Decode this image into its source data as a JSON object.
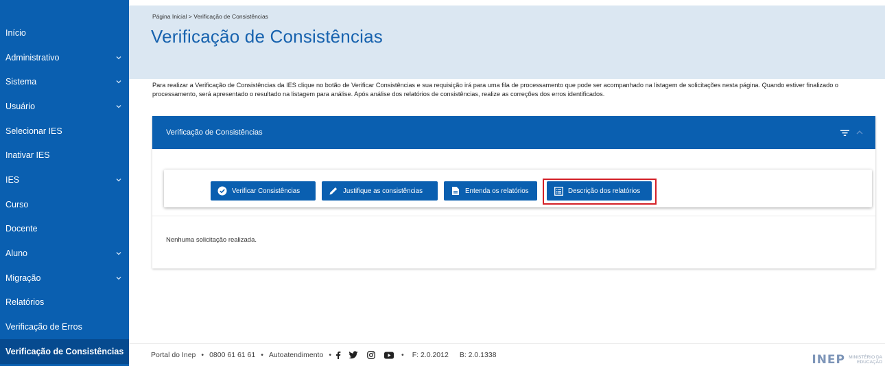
{
  "sidebar": {
    "items": [
      {
        "label": "Início",
        "has_chevron": false
      },
      {
        "label": "Administrativo",
        "has_chevron": true
      },
      {
        "label": "Sistema",
        "has_chevron": true
      },
      {
        "label": "Usuário",
        "has_chevron": true
      },
      {
        "label": "Selecionar IES",
        "has_chevron": false
      },
      {
        "label": "Inativar IES",
        "has_chevron": false
      },
      {
        "label": "IES",
        "has_chevron": true
      },
      {
        "label": "Curso",
        "has_chevron": false
      },
      {
        "label": "Docente",
        "has_chevron": false
      },
      {
        "label": "Aluno",
        "has_chevron": true
      },
      {
        "label": "Migração",
        "has_chevron": true
      },
      {
        "label": "Relatórios",
        "has_chevron": false
      },
      {
        "label": "Verificação de Erros",
        "has_chevron": false
      },
      {
        "label": "Verificação de Consistências",
        "has_chevron": false,
        "active": true
      }
    ]
  },
  "header": {
    "breadcrumb": "Página Inicial > Verificação de Consistências",
    "title": "Verificação de Consistências"
  },
  "description": "Para realizar a Verificação de Consistências da IES clique no botão de Verificar Consistências e sua requisição irá para uma fila de processamento que pode ser acompanhado na listagem de solicitações nesta página. Quando estiver finalizado o processamento, será apresentado o resultado na listagem para análise. Após análise dos relatórios de consistências, realize as correções dos erros identificados.",
  "panel": {
    "title": "Verificação de Consistências",
    "buttons": {
      "verificar": "Verificar Consistências",
      "justifique": "Justifique as consistências",
      "entenda": "Entenda os relatórios",
      "descricao": "Descrição dos relatórios"
    },
    "empty_message": "Nenhuma solicitação realizada."
  },
  "footer": {
    "portal": "Portal do Inep",
    "bullet": "•",
    "phone": "0800 61 61 61",
    "autoatendimento": "Autoatendimento",
    "frontend_version": "F: 2.0.2012",
    "backend_version": "B: 2.0.1338",
    "logo_text": "INEP",
    "ministry_text": "MINISTÉRIO DA EDUCAÇÃO"
  },
  "colors": {
    "primary": "#0a5fb0",
    "header_band": "#dbe7f2",
    "highlight": "#d42027"
  }
}
